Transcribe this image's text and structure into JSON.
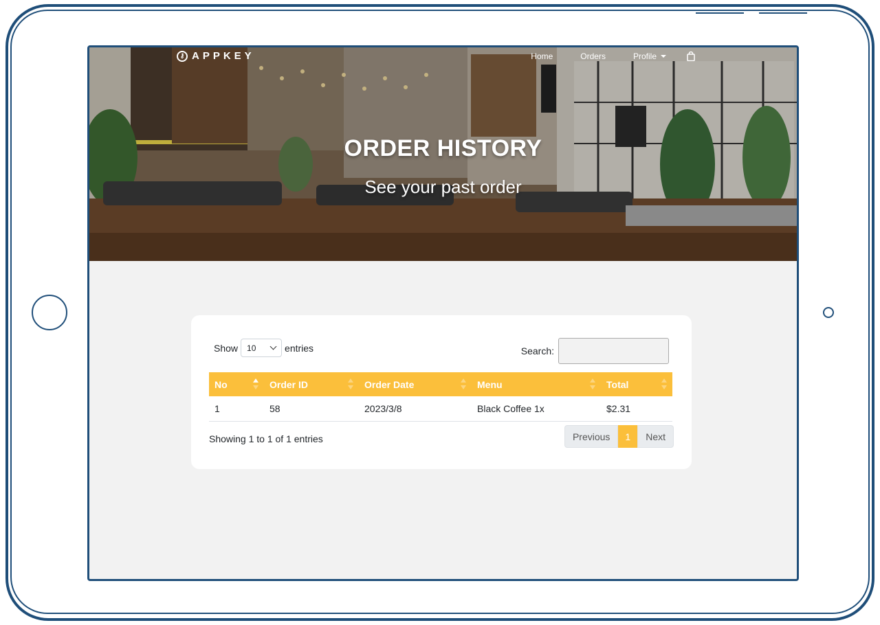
{
  "brand": {
    "name": "APPKEY"
  },
  "nav": {
    "home": "Home",
    "orders": "Orders",
    "profile": "Profile",
    "cart_icon": "shopping-bag-icon"
  },
  "hero": {
    "title": "ORDER HISTORY",
    "subtitle": "See your past order"
  },
  "table_controls": {
    "show_label": "Show",
    "entries_value": "10",
    "entries_label": "entries",
    "search_label": "Search:",
    "search_value": ""
  },
  "table": {
    "columns": [
      "No",
      "Order ID",
      "Order Date",
      "Menu",
      "Total"
    ],
    "sorted_column": "No",
    "sort_direction": "ascending",
    "rows": [
      [
        "1",
        "58",
        "2023/3/8",
        "Black Coffee 1x",
        "$2.31"
      ]
    ]
  },
  "footer": {
    "info": "Showing 1 to 1 of 1 entries",
    "previous": "Previous",
    "page": "1",
    "next": "Next"
  },
  "colors": {
    "accent": "#fbbf3b",
    "frame": "#1f4e79",
    "background": "#f2f2f2"
  }
}
